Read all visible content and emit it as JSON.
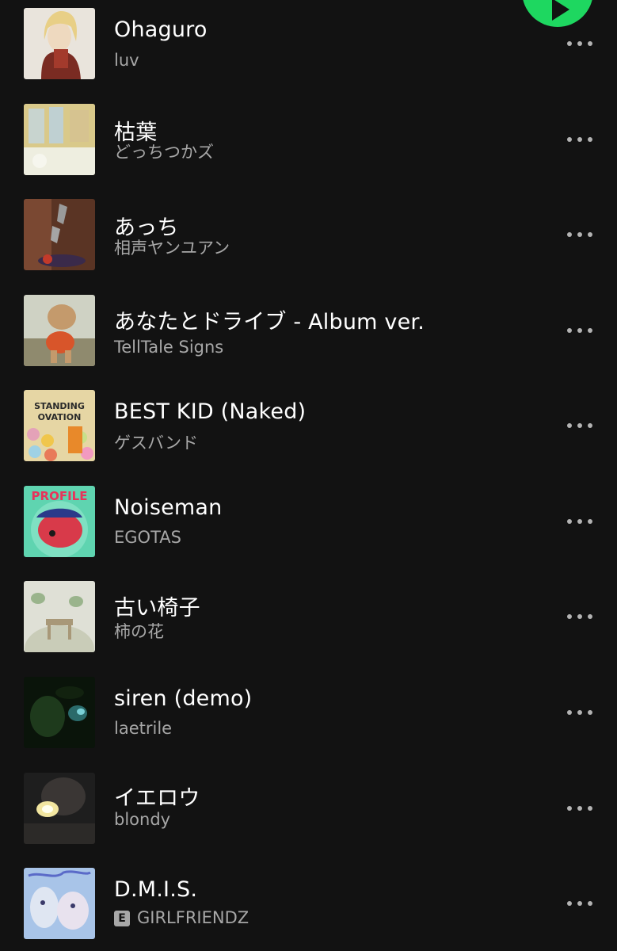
{
  "play_button": {
    "icon": "play-icon",
    "color": "#1ed760"
  },
  "tracks": [
    {
      "title": "Ohaguro",
      "artist": "luv",
      "explicit": false
    },
    {
      "title": "枯葉",
      "artist": "どっちつかズ",
      "explicit": false
    },
    {
      "title": "あっち",
      "artist": "相声ヤンユアン",
      "explicit": false
    },
    {
      "title": "あなたとドライブ - Album ver.",
      "artist": "TellTale Signs",
      "explicit": false
    },
    {
      "title": "BEST KID (Naked)",
      "artist": "ゲスバンド",
      "explicit": false
    },
    {
      "title": "Noiseman",
      "artist": "EGOTAS",
      "explicit": false
    },
    {
      "title": "古い椅子",
      "artist": "柿の花",
      "explicit": false
    },
    {
      "title": "siren (demo)",
      "artist": "laetrile",
      "explicit": false
    },
    {
      "title": "イエロウ",
      "artist": "blondy",
      "explicit": false
    },
    {
      "title": "D.M.I.S.",
      "artist": "GIRLFRIENDZ",
      "explicit": true,
      "explicit_label": "E"
    }
  ],
  "cover_art": [
    {
      "text": ""
    },
    {
      "text": ""
    },
    {
      "text": ""
    },
    {
      "text": ""
    },
    {
      "text": "STANDING OVATION"
    },
    {
      "text": "PROFILE"
    },
    {
      "text": ""
    },
    {
      "text": ""
    },
    {
      "text": ""
    },
    {
      "text": ""
    }
  ],
  "more_icon": "more-options-icon"
}
